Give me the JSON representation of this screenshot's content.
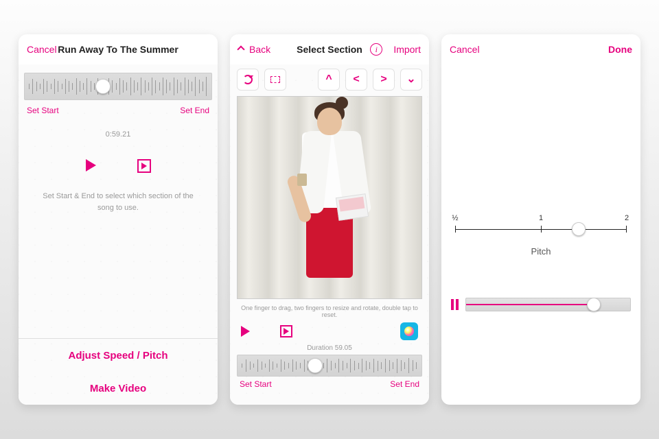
{
  "screen1": {
    "cancel": "Cancel",
    "title": "Run Away To The Summer",
    "set_start": "Set Start",
    "set_end": "Set End",
    "time": "0:59.21",
    "hint": "Set Start & End to select which section of the song to use.",
    "adjust": "Adjust Speed / Pitch",
    "make_video": "Make Video",
    "slider_pos_pct": 42
  },
  "screen2": {
    "back": "Back",
    "title": "Select Section",
    "import": "Import",
    "hint": "One finger to drag, two fingers to resize and rotate, double tap to reset.",
    "duration": "Duration 59.05",
    "set_start": "Set Start",
    "set_end": "Set End",
    "slider_pos_pct": 42
  },
  "screen3": {
    "cancel": "Cancel",
    "done": "Done",
    "ticks": {
      "half": "½",
      "one": "1",
      "two": "2"
    },
    "pitch_label": "Pitch",
    "scale_knob_pct": 68,
    "playbar_fill_pct": 78,
    "playbar_knob_pct": 78
  }
}
